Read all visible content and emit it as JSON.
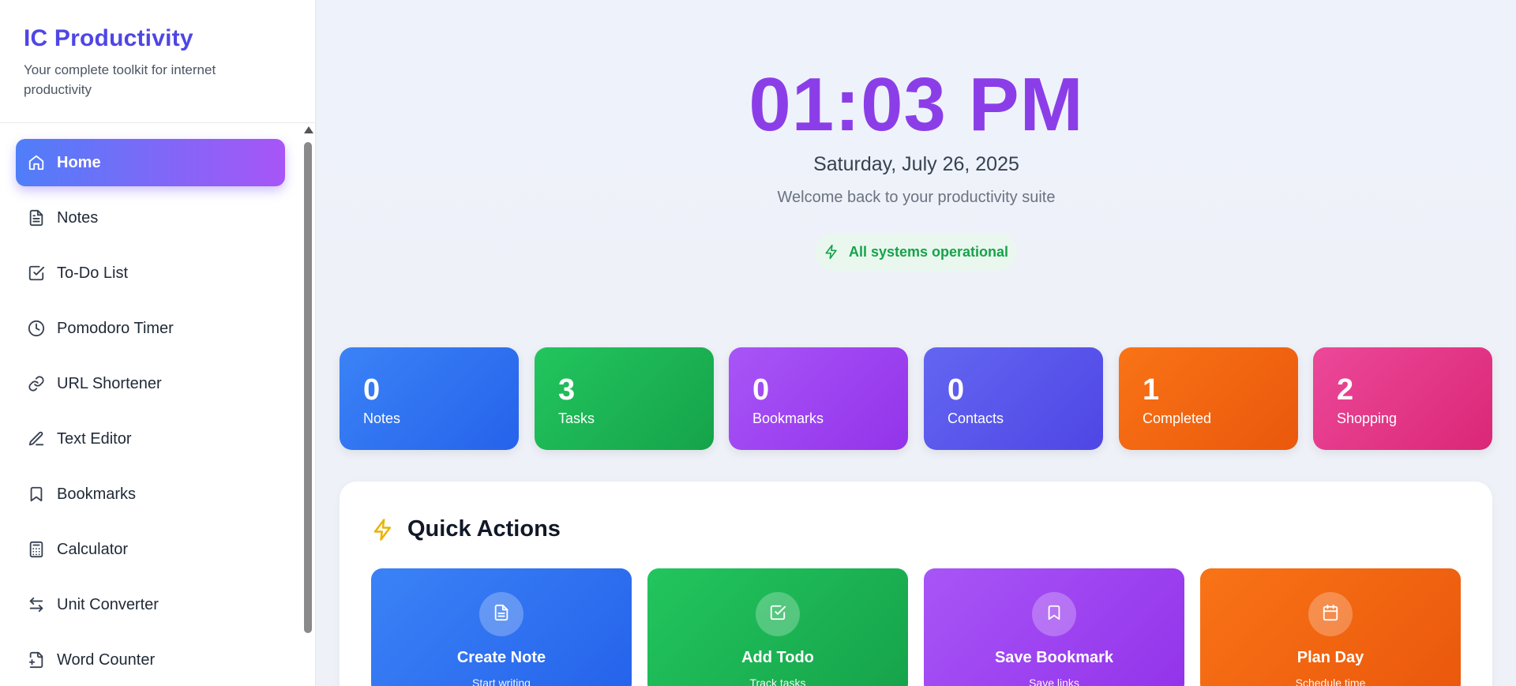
{
  "sidebar": {
    "title": "IC Productivity",
    "subtitle": "Your complete toolkit for internet productivity",
    "items": [
      {
        "label": "Home",
        "icon": "home-icon",
        "active": true
      },
      {
        "label": "Notes",
        "icon": "document-icon"
      },
      {
        "label": "To-Do List",
        "icon": "checkbox-icon"
      },
      {
        "label": "Pomodoro Timer",
        "icon": "clock-icon"
      },
      {
        "label": "URL Shortener",
        "icon": "link-icon"
      },
      {
        "label": "Text Editor",
        "icon": "pen-icon"
      },
      {
        "label": "Bookmarks",
        "icon": "bookmark-icon"
      },
      {
        "label": "Calculator",
        "icon": "calculator-icon"
      },
      {
        "label": "Unit Converter",
        "icon": "arrows-exchange-icon"
      },
      {
        "label": "Word Counter",
        "icon": "file-count-icon"
      }
    ]
  },
  "hero": {
    "time": "01:03 PM",
    "date": "Saturday, July 26, 2025",
    "welcome": "Welcome back to your productivity suite",
    "status": "All systems operational"
  },
  "stats": [
    {
      "value": "0",
      "label": "Notes",
      "color_from": "#3b82f6",
      "color_to": "#2563eb"
    },
    {
      "value": "3",
      "label": "Tasks",
      "color_from": "#22c55e",
      "color_to": "#16a34a"
    },
    {
      "value": "0",
      "label": "Bookmarks",
      "color_from": "#a855f7",
      "color_to": "#9333ea"
    },
    {
      "value": "0",
      "label": "Contacts",
      "color_from": "#6366f1",
      "color_to": "#4f46e5"
    },
    {
      "value": "1",
      "label": "Completed",
      "color_from": "#f97316",
      "color_to": "#ea580c"
    },
    {
      "value": "2",
      "label": "Shopping",
      "color_from": "#ec4899",
      "color_to": "#db2777"
    }
  ],
  "quick_actions": {
    "title": "Quick Actions",
    "items": [
      {
        "label": "Create Note",
        "sub": "Start writing",
        "icon": "document-icon",
        "color_from": "#3b82f6",
        "color_to": "#2563eb"
      },
      {
        "label": "Add Todo",
        "sub": "Track tasks",
        "icon": "checkbox-icon",
        "color_from": "#22c55e",
        "color_to": "#16a34a"
      },
      {
        "label": "Save Bookmark",
        "sub": "Save links",
        "icon": "bookmark-icon",
        "color_from": "#a855f7",
        "color_to": "#9333ea"
      },
      {
        "label": "Plan Day",
        "sub": "Schedule time",
        "icon": "calendar-icon",
        "color_from": "#f97316",
        "color_to": "#ea580c"
      }
    ]
  }
}
